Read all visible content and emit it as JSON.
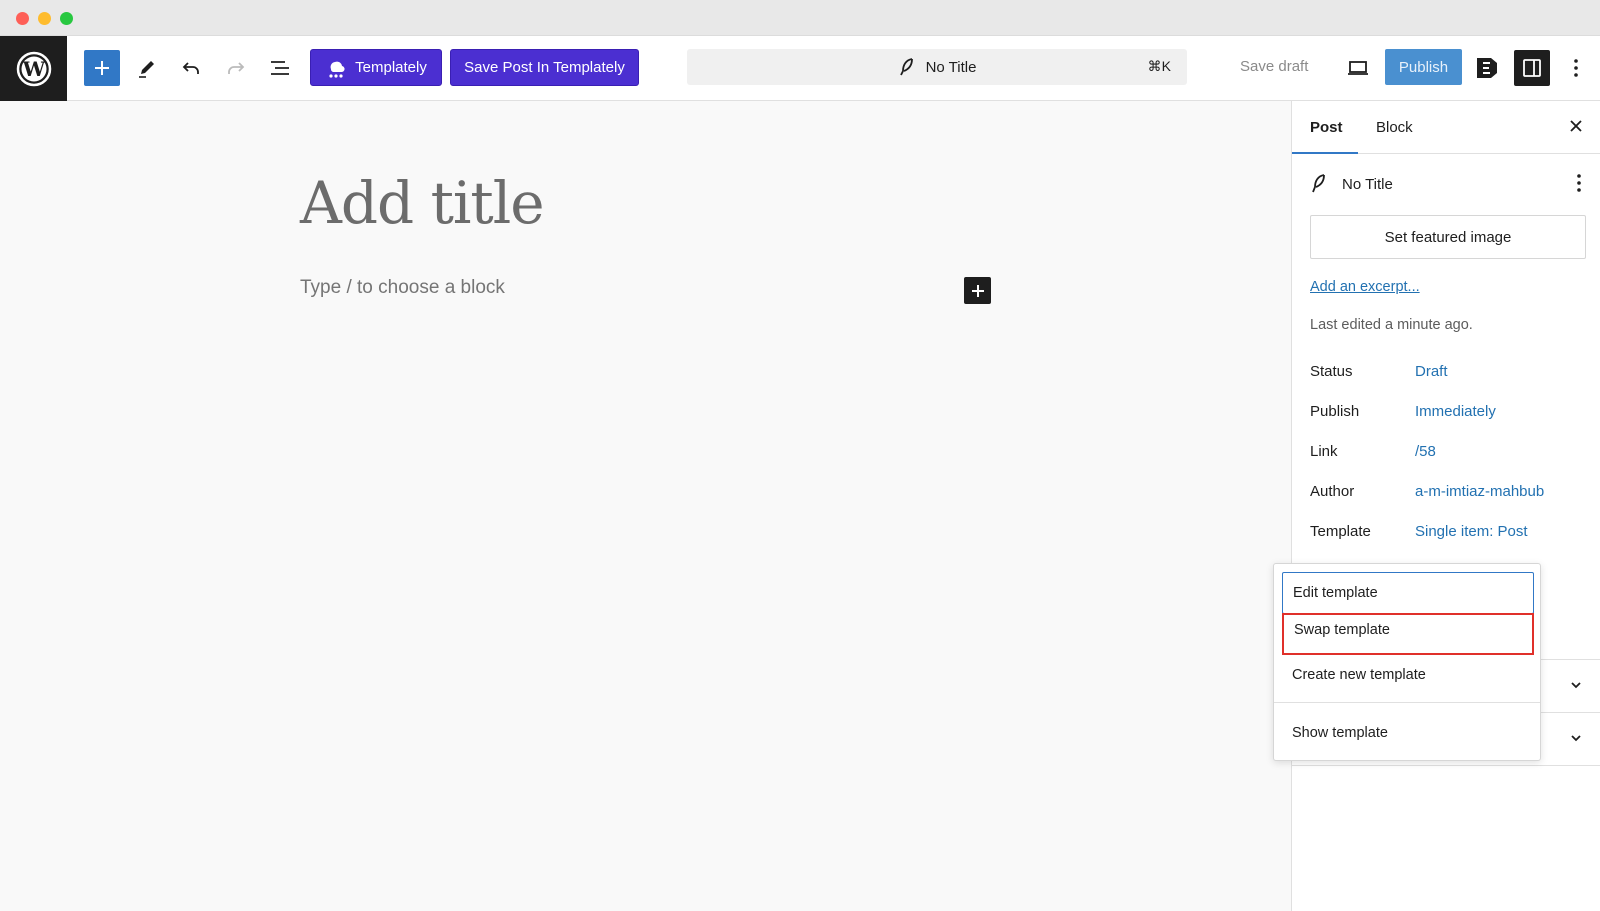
{
  "toolbar": {
    "templately_label": "Templately",
    "save_templately_label": "Save Post In Templately",
    "command_title": "No Title",
    "command_shortcut": "⌘K",
    "save_draft_label": "Save draft",
    "publish_label": "Publish"
  },
  "editor": {
    "title_placeholder": "Add title",
    "block_placeholder": "Type / to choose a block"
  },
  "sidebar": {
    "tabs": [
      "Post",
      "Block"
    ],
    "post_title": "No Title",
    "featured_image_label": "Set featured image",
    "excerpt_link": "Add an excerpt...",
    "last_edited": "Last edited a minute ago.",
    "rows": [
      {
        "label": "Status",
        "value": "Draft"
      },
      {
        "label": "Publish",
        "value": "Immediately"
      },
      {
        "label": "Link",
        "value": "/58"
      },
      {
        "label": "Author",
        "value": "a-m-imtiaz-mahbub"
      },
      {
        "label": "Template",
        "value": "Single item: Post"
      }
    ]
  },
  "template_menu": {
    "items": [
      "Edit template",
      "Swap template",
      "Create new template",
      "Show template"
    ],
    "highlighted": "Swap template"
  },
  "colors": {
    "wp_blue": "#3178c6",
    "templately_purple": "#4b2fd1",
    "link_blue": "#2271b1",
    "highlight_red": "#e0302a"
  }
}
